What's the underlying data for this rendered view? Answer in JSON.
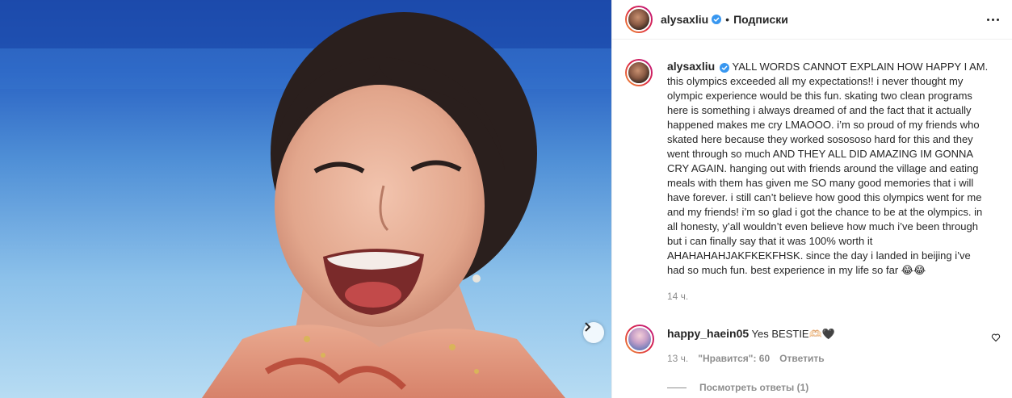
{
  "colors": {
    "link_blue": "#3897f0",
    "text_primary": "#262626",
    "text_secondary": "#8e8e8e",
    "story_ring_start": "#f09433",
    "story_ring_end": "#bc1888"
  },
  "icons": {
    "verified": "verified-badge-icon",
    "more": "more-options-icon",
    "next": "chevron-right-icon",
    "like": "heart-outline-icon"
  },
  "header": {
    "username": "alysaxliu",
    "separator": "•",
    "follow_label": "Подписки"
  },
  "caption": {
    "username": "alysaxliu",
    "text": "YALL WORDS CANNOT EXPLAIN HOW HAPPY I AM. this olympics exceeded all my expectations!! i never thought my olympic experience would be this fun. skating two clean programs here is something i always dreamed of and the fact that it actually happened makes me cry LMAOOO. i’m so proud of my friends who skated here because they worked sosososo hard for this and they went through so much AND THEY ALL DID AMAZING IM GONNA CRY AGAIN. hanging out with friends around the village and eating meals with them has given me SO many good memories that i will have forever. i still can’t believe how good this olympics went for me and my friends! i’m so glad i got the chance to be at the olympics. in all honesty, y’all wouldn’t even believe how much i’ve been through but i can finally say that it was 100% worth it AHAHAHAHJAKFKEKFHSK. since the day i landed in beijing i’ve had so much fun. best experience in my life so far 😂😂",
    "time": "14 ч."
  },
  "comment": {
    "username": "happy_haein05",
    "text": "Yes BESTIE🫶🏻🖤",
    "time": "13 ч.",
    "likes_label": "\"Нравится\": 60",
    "reply_label": "Ответить",
    "view_replies_label": "Посмотреть ответы (1)"
  }
}
